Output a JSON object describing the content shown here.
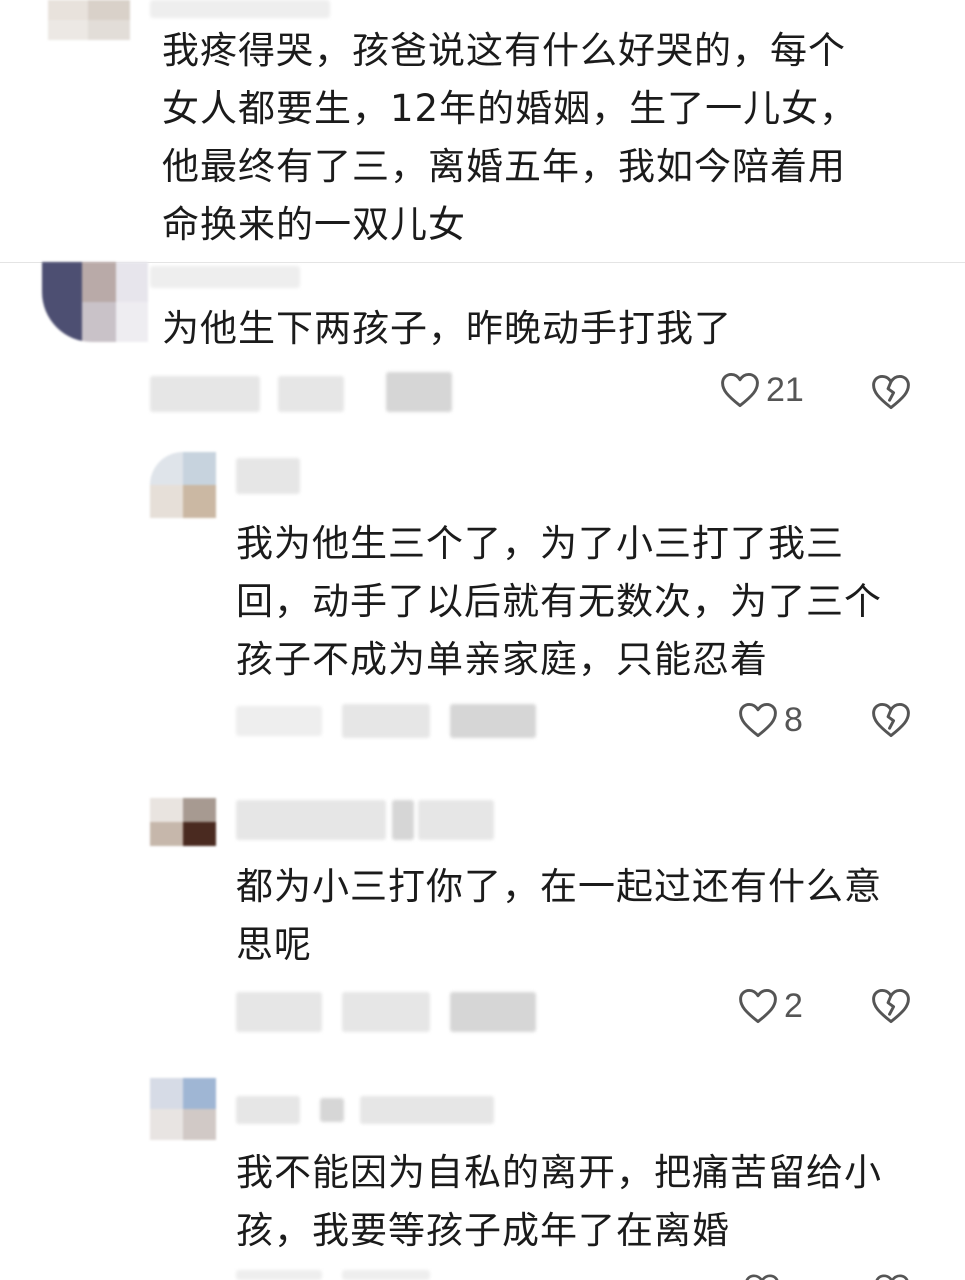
{
  "comments": [
    {
      "text": "我疼得哭，孩爸说这有什么好哭的，每个\n女人都要生，12年的婚姻，生了一儿女，\n他最终有了三，离婚五年，我如今陪着用\n命换来的一双儿女"
    },
    {
      "text": "为他生下两孩子，昨晚动手打我了",
      "likes": "21"
    }
  ],
  "replies": [
    {
      "text": "我为他生三个了，为了小三打了我三\n回，动手了以后就有无数次，为了三个\n孩子不成为单亲家庭，只能忍着",
      "likes": "8"
    },
    {
      "text": "都为小三打你了，在一起过还有什么意\n思呢",
      "likes": "2"
    },
    {
      "text": "我不能因为自私的离开，把痛苦留给小\n孩，我要等孩子成年了在离婚"
    }
  ],
  "icons": {
    "like": "heart-outline-icon",
    "dislike": "broken-heart-icon"
  }
}
